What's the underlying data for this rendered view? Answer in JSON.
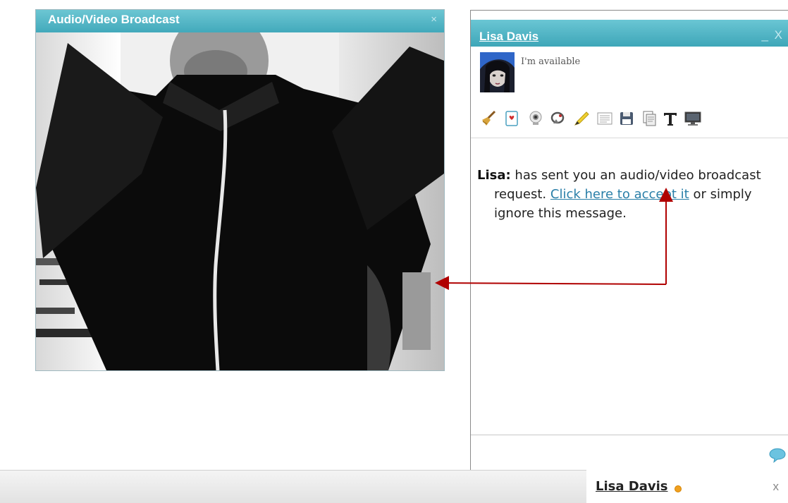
{
  "broadcast_window": {
    "title": "Audio/Video Broadcast",
    "close_label": "×"
  },
  "chat_window": {
    "contact_name": "Lisa Davis",
    "minimize_label": "_",
    "close_label": "X",
    "status_text": "I'm available",
    "toolbar_icons": [
      "broom-icon",
      "card-icon",
      "webcam-icon",
      "satellite-icon",
      "pencil-icon",
      "log-icon",
      "save-icon",
      "copy-icon",
      "font-icon",
      "screen-icon"
    ],
    "message": {
      "sender": "Lisa:",
      "text_before": " has sent you an audio/video broadcast request. ",
      "link_text": "Click here to accept it",
      "text_after": " or simply ignore this message."
    },
    "compose_icon": "chat-bubble-icon"
  },
  "bottom_tab": {
    "name": "Lisa Davis",
    "close_label": "x",
    "status_color": "#f0a020"
  },
  "colors": {
    "titlebar": "#42a9bb",
    "link": "#2a7fa8",
    "arrow": "#b00000"
  }
}
